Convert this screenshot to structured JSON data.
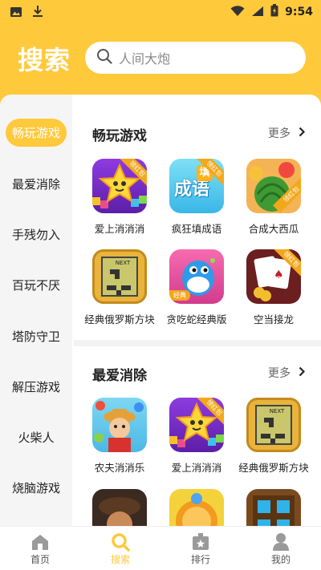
{
  "statusbar": {
    "time": "9:54"
  },
  "header": {
    "title": "搜索",
    "search_placeholder": "人间大炮"
  },
  "sidebar": {
    "items": [
      {
        "label": "畅玩游戏",
        "active": true
      },
      {
        "label": "最爱消除"
      },
      {
        "label": "手残勿入"
      },
      {
        "label": "百玩不厌"
      },
      {
        "label": "塔防守卫"
      },
      {
        "label": "解压游戏"
      },
      {
        "label": "火柴人"
      },
      {
        "label": "烧脑游戏"
      }
    ]
  },
  "sections": [
    {
      "title": "畅玩游戏",
      "more": "更多",
      "games": [
        {
          "name": "爱上消消消",
          "badge": "领红包"
        },
        {
          "name": "疯狂填成语",
          "badge": "领红包",
          "icon_text": "成语",
          "icon_text2": "填"
        },
        {
          "name": "合成大西瓜",
          "badge": "领红包"
        },
        {
          "name": "经典俄罗斯方块",
          "icon_text": "NEXT"
        },
        {
          "name": "贪吃蛇经典版",
          "badge": "经典"
        },
        {
          "name": "空当接龙",
          "badge": "领红包"
        }
      ]
    },
    {
      "title": "最爱消除",
      "more": "更多",
      "games": [
        {
          "name": "农夫消消乐"
        },
        {
          "name": "爱上消消消",
          "badge": "领红包"
        },
        {
          "name": "经典俄罗斯方块",
          "icon_text": "NEXT"
        }
      ]
    }
  ],
  "tabbar": [
    {
      "label": "首页"
    },
    {
      "label": "搜索",
      "active": true
    },
    {
      "label": "排行"
    },
    {
      "label": "我的"
    }
  ],
  "colors": {
    "accent": "#FFC93C",
    "sidebar_bg": "#F5F5F5"
  }
}
